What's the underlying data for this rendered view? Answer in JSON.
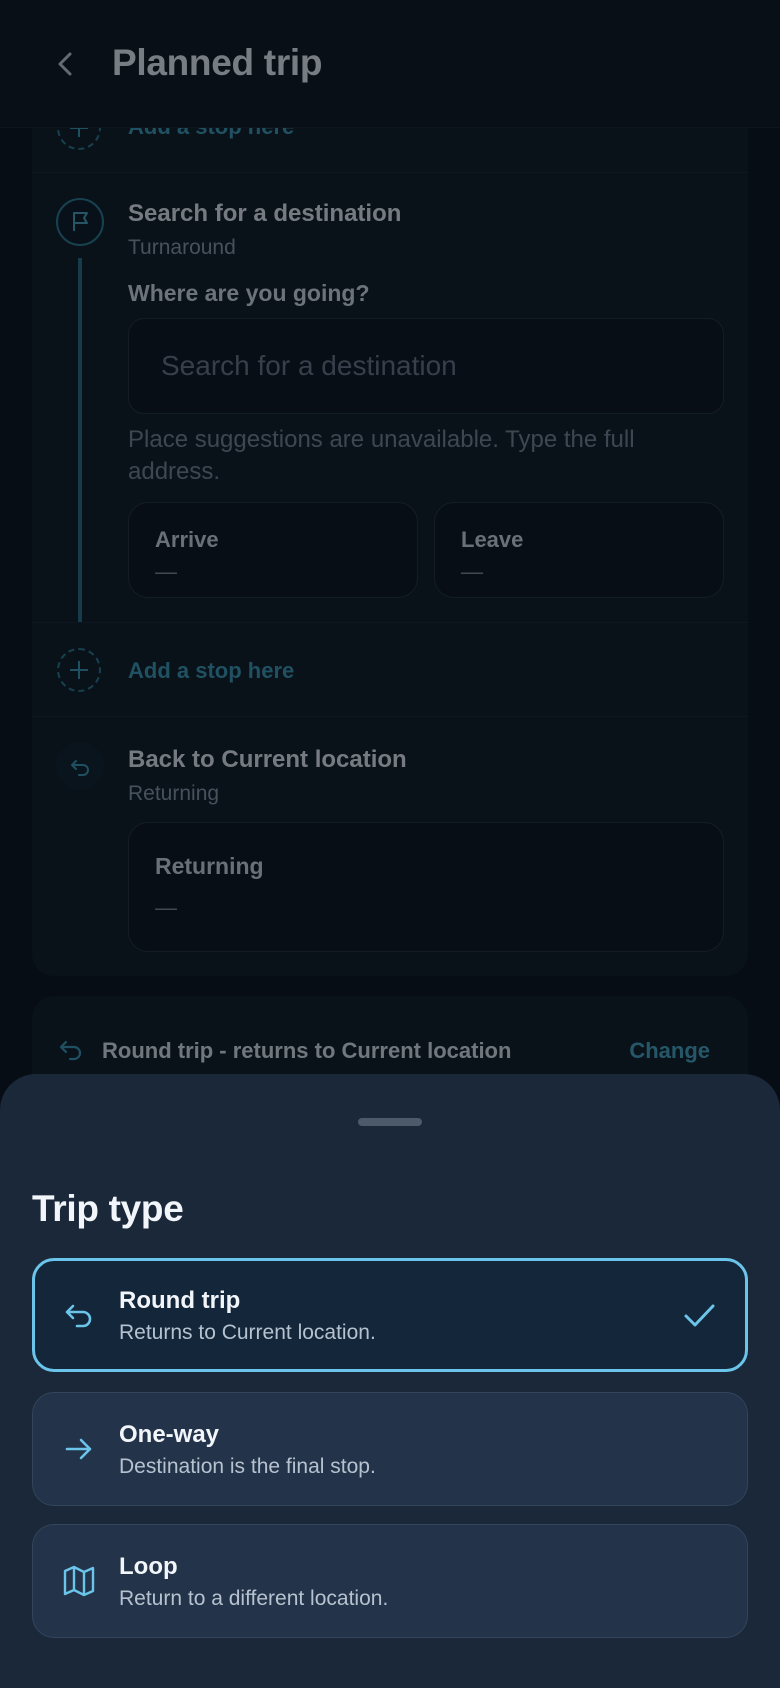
{
  "header": {
    "title": "Planned trip"
  },
  "stops": {
    "add_stop_label": "Add a stop here",
    "destination": {
      "title": "Search for a destination",
      "subtitle": "Turnaround",
      "question": "Where are you going?",
      "search_placeholder": "Search for a destination",
      "hint": "Place suggestions are unavailable. Type the full address.",
      "arrive_label": "Arrive",
      "arrive_value": "—",
      "leave_label": "Leave",
      "leave_value": "—"
    },
    "return_stop": {
      "title": "Back to Current location",
      "subtitle": "Returning",
      "returning_label": "Returning",
      "returning_value": "—"
    }
  },
  "round_trip_bar": {
    "text": "Round trip - returns to Current location",
    "change_label": "Change"
  },
  "sheet": {
    "title": "Trip type",
    "options": [
      {
        "title": "Round trip",
        "description": "Returns to Current location.",
        "icon": "return-arrow-icon",
        "selected": true
      },
      {
        "title": "One-way",
        "description": "Destination is the final stop.",
        "icon": "arrow-right-icon",
        "selected": false
      },
      {
        "title": "Loop",
        "description": "Return to a different location.",
        "icon": "map-icon",
        "selected": false
      }
    ]
  },
  "colors": {
    "accent": "#6bc4ea",
    "teal": "#3f9ab7",
    "sheet_bg": "#1a2839",
    "option_bg": "#233349",
    "selected_bg": "#13263a",
    "page_bg": "#0b121a"
  }
}
